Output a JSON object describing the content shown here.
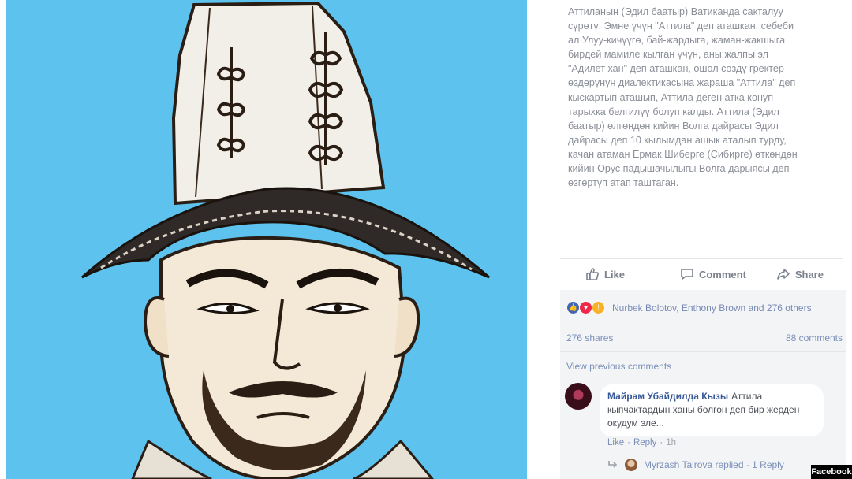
{
  "post": {
    "caption": "Аттиланын (Эдил баатыр) Ватиканда сакталуу\nсүрөтү. Эмне үчүн \"Аттила\" деп аташкан, себеби\nал Улуу-кичүүгө, бай-жардыга, жаман-жакшыга\nбирдей мамиле кылган үчүн, аны жалпы эл\n\"Адилет хан\" деп аташкан, ошол сөздү гректер\nөздөрүнүн диалектикасына жараша \"Аттила\" деп\nкыскартып аташып, Аттила деген атка конуп\nтарыхка белгилүү болуп калды. Аттила (Эдил\nбаатыр) өлгөндөн кийин Волга дайрасы Эдил\nдайрасы деп 10 кылымдан ашык аталып турду,\nкачан атаман Ермак Шиберге (Сибирге) өткөндөн\nкийин Орус падышачылыгы Волга дарыясы деп\nөзгөртүп атап таштаган."
  },
  "actions": {
    "like": "Like",
    "comment": "Comment",
    "share": "Share"
  },
  "engagement": {
    "reactions_text": "Nurbek Bolotov, Enthony Brown and 276 others",
    "shares": "276 shares",
    "comments": "88 comments",
    "view_previous": "View previous comments"
  },
  "comment": {
    "author": "Майрам Убайдилда Кызы",
    "text": "Аттила кыпчактардын ханы болгон деп бир жерден окудум эле...",
    "like_label": "Like",
    "reply_label": "Reply",
    "time": "1h"
  },
  "reply_thread": {
    "text": "Myrzash Tairova replied · 1 Reply"
  },
  "watermark": "Facebook",
  "colors": {
    "photo_background": "#5dc3ee",
    "link_blue": "#385898",
    "caption_gray": "#8b8f98"
  }
}
